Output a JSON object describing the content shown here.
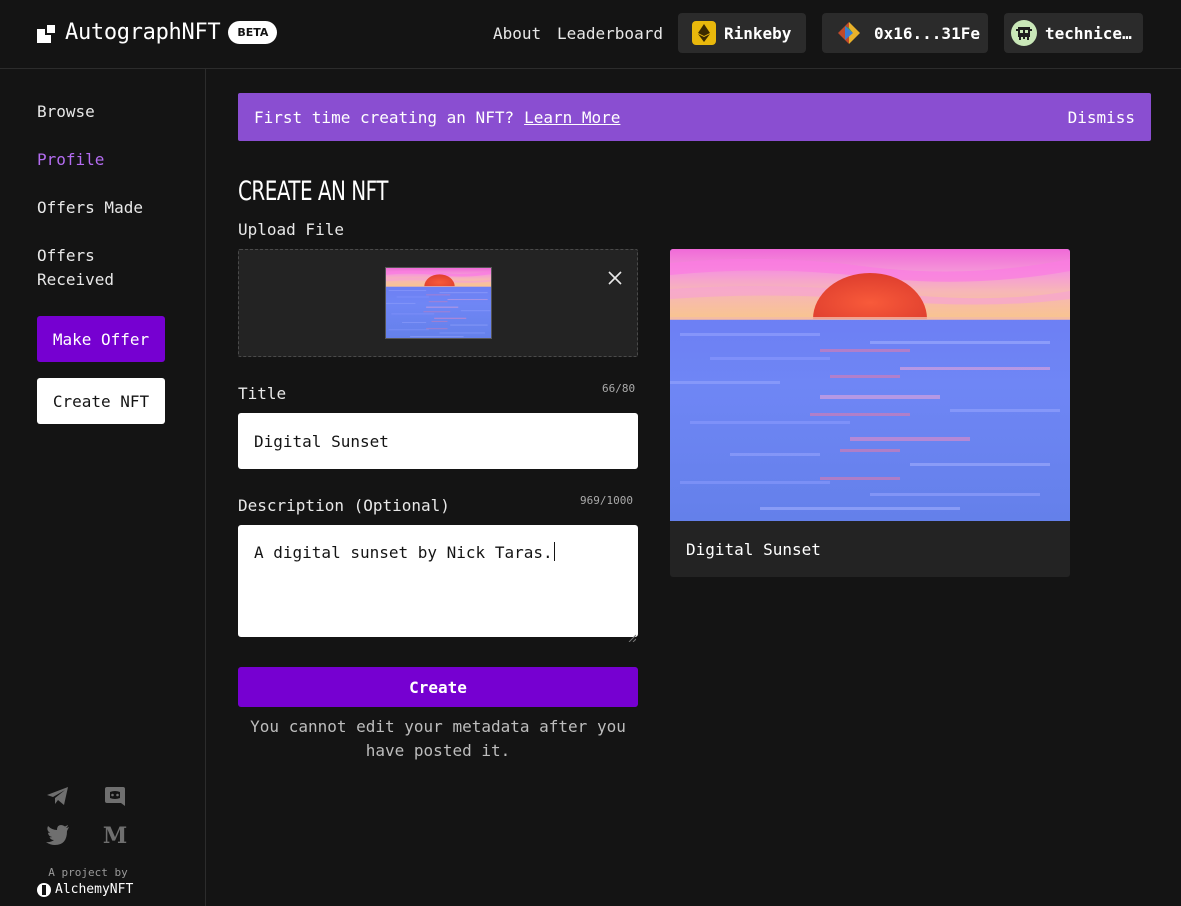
{
  "header": {
    "brand": "AutographNFT",
    "badge": "BETA",
    "nav": {
      "about": "About",
      "leaderboard": "Leaderboard"
    },
    "network": "Rinkeby",
    "wallet": "0x16...31Fe",
    "user": "technice…"
  },
  "sidebar": {
    "items": [
      {
        "label": "Browse"
      },
      {
        "label": "Profile"
      },
      {
        "label": "Offers Made"
      },
      {
        "label": "Offers\nReceived"
      }
    ],
    "make_offer": "Make Offer",
    "create_nft": "Create NFT",
    "socials": [
      "telegram-icon",
      "discord-icon",
      "twitter-icon",
      "medium-icon"
    ],
    "project_by": "A project by",
    "company": "AlchemyNFT"
  },
  "banner": {
    "text": "First time creating an NFT?",
    "link": "Learn More",
    "dismiss": "Dismiss"
  },
  "form": {
    "page_title": "CREATE AN NFT",
    "upload_label": "Upload File",
    "title_label": "Title",
    "title_count": "66/80",
    "title_value": "Digital Sunset",
    "description_label": "Description (Optional)",
    "description_count": "969/1000",
    "description_value": "A digital sunset by Nick Taras.",
    "create_button": "Create",
    "note": "You cannot edit your metadata after you have posted it."
  },
  "preview": {
    "title": "Digital Sunset"
  },
  "colors": {
    "accent": "#7600d1",
    "banner": "#8a4ed1",
    "active_nav": "#b36cf0",
    "background": "#141414"
  }
}
